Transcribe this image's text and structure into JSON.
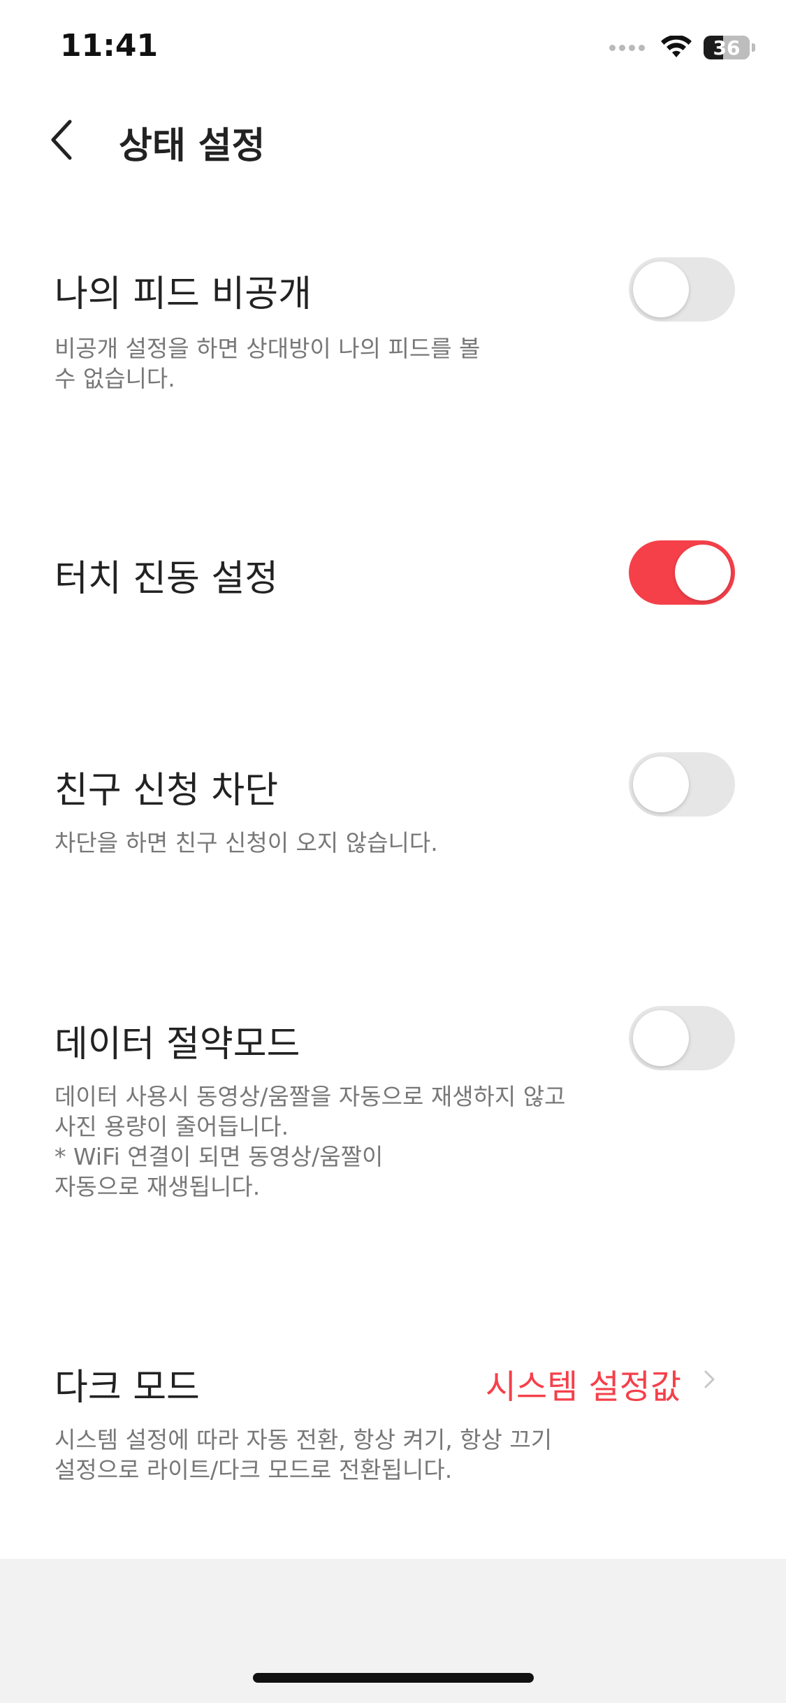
{
  "status_bar": {
    "time": "11:41",
    "battery": "36",
    "icons": [
      "signal-icon",
      "wifi-icon",
      "battery-icon"
    ]
  },
  "header": {
    "back_icon": "chevron-left-icon",
    "title": "상태 설정"
  },
  "settings": {
    "private_feed": {
      "title": "나의 피드 비공개",
      "desc_lines": [
        "비공개 설정을 하면 상대방이 나의 피드를 볼",
        "수 없습니다."
      ],
      "enabled": false
    },
    "touch_vibration": {
      "title": "터치 진동 설정",
      "enabled": true
    },
    "block_friend_request": {
      "title": "친구 신청 차단",
      "desc_lines": [
        "차단을 하면 친구 신청이 오지 않습니다."
      ],
      "enabled": false
    },
    "data_saver": {
      "title": "데이터 절약모드",
      "desc_lines": [
        "데이터 사용시 동영상/움짤을 자동으로 재생하지 않고",
        "사진 용량이 줄어듭니다.",
        "* WiFi 연결이 되면 동영상/움짤이",
        "자동으로 재생됩니다."
      ],
      "enabled": false
    },
    "dark_mode": {
      "title": "다크 모드",
      "value": "시스템 설정값",
      "desc_lines": [
        "시스템 설정에 따라 자동 전환, 항상 켜기, 항상 끄기",
        "설정으로 라이트/다크 모드로 전환됩니다."
      ]
    }
  },
  "colors": {
    "accent": "#f5404a",
    "toggle_off": "#e6e6e6",
    "title_text": "#222222",
    "desc_text": "#777777",
    "bottom_background": "#f2f2f2"
  }
}
